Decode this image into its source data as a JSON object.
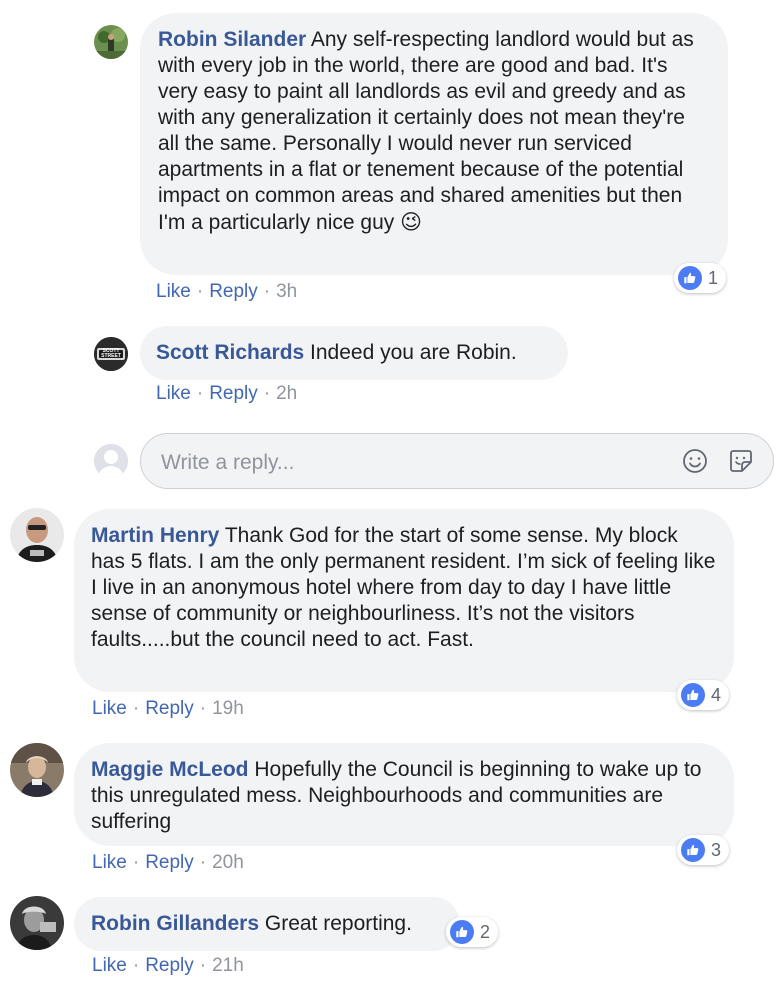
{
  "comments": [
    {
      "author": "Robin Silander",
      "text": "Any self-respecting landlord would but as with every job in the world, there are good and bad. It's very easy to paint all landlords as evil and greedy and as with any generalization it certainly does not mean they're all the same. Personally I would never run serviced apartments in a flat or tenement because of the potential impact on common areas and shared amenities but then I'm a particularly nice guy",
      "emoji": "😉",
      "like_label": "Like",
      "reply_label": "Reply",
      "time": "3h",
      "reactions": "1"
    },
    {
      "author": "Scott Richards",
      "text": "Indeed you are Robin.",
      "like_label": "Like",
      "reply_label": "Reply",
      "time": "2h"
    },
    {
      "author": "Martin Henry",
      "text": "Thank God for the start of some sense. My block has 5 flats. I am the only permanent resident. I’m sick of feeling like I live in an anonymous hotel where from day to day I have little sense of community or neighbourliness. It’s not the visitors faults.....but the council need to act. Fast.",
      "like_label": "Like",
      "reply_label": "Reply",
      "time": "19h",
      "reactions": "4"
    },
    {
      "author": "Maggie McLeod",
      "text": "Hopefully the Council is beginning to wake up to this unregulated mess. Neighbourhoods and communities are suffering",
      "like_label": "Like",
      "reply_label": "Reply",
      "time": "20h",
      "reactions": "3"
    },
    {
      "author": "Robin Gillanders",
      "text": "Great reporting.",
      "like_label": "Like",
      "reply_label": "Reply",
      "time": "21h",
      "reactions": "2"
    }
  ],
  "avatar_badge": {
    "line1": "SCOTT",
    "line2": "STREET"
  },
  "reply_box": {
    "placeholder": "Write a reply..."
  },
  "colors": {
    "author": "#385898",
    "link": "#4267b2",
    "bubble": "#f2f3f5",
    "like_blue": "#4c7cf3"
  }
}
